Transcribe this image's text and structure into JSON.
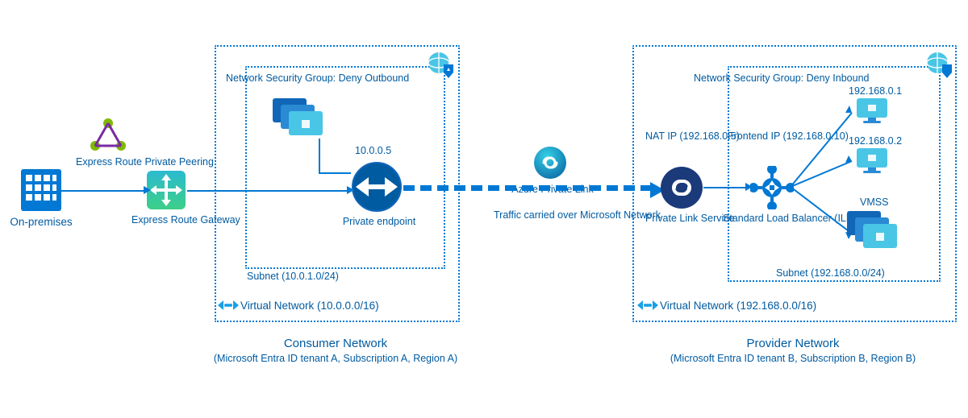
{
  "consumer": {
    "nsg": "Network Security Group: Deny Outbound",
    "vnet": "Virtual Network (10.0.0.0/16)",
    "subnet": "Subnet (10.0.1.0/24)",
    "label": "Consumer Network",
    "sub": "(Microsoft Entra ID tenant A, Subscription A, Region A)"
  },
  "provider": {
    "nsg": "Network Security Group: Deny Inbound",
    "vnet": "Virtual Network (192.168.0.0/16)",
    "subnet": "Subnet (192.168.0.0/24)",
    "label": "Provider Network",
    "sub": "(Microsoft Entra ID tenant B, Subscription B, Region B)"
  },
  "onprem": "On-premises",
  "er_peering": "Express Route Private Peering",
  "er_gateway": "Express Route Gateway",
  "pe_ip": "10.0.0.5",
  "pe": "Private endpoint",
  "apl": "Azure Private Link",
  "traffic": "Traffic carried over Microsoft Network",
  "pls": "Private Link Service",
  "nat_ip": "NAT IP (192.168.0.5)",
  "fe_ip": "Frontend IP (192.168.0.10)",
  "slb": "Standard Load Balancer (ILB/PLB)",
  "vm1_ip": "192.168.0.1",
  "vm2_ip": "192.168.0.2",
  "vmss": "VMSS"
}
